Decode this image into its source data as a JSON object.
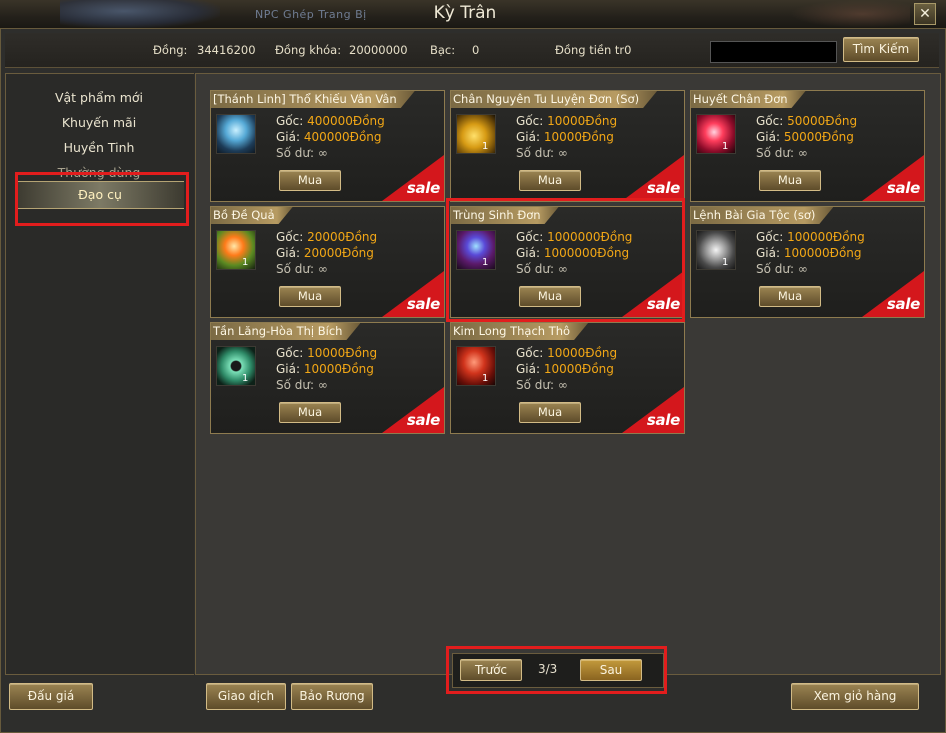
{
  "window": {
    "title": "Kỳ Trân",
    "background_subtitle": "NPC Ghép Trang Bị",
    "close_glyph": "✕"
  },
  "currency": {
    "dong_label": "Đồng:",
    "dong_value": "34416200",
    "dong_khoa_label": "Đồng khóa:",
    "dong_khoa_value": "20000000",
    "bac_label": "Bạc:",
    "bac_value": "0",
    "dong_tien_label": "Đồng tiền tr0",
    "search_button": "Tìm Kiếm"
  },
  "sidebar": {
    "items": [
      {
        "label": "Vật phẩm mới"
      },
      {
        "label": "Khuyến mãi"
      },
      {
        "label": "Huyền Tinh"
      },
      {
        "label": "Thường dùng"
      },
      {
        "label": "Đạo cụ"
      }
    ],
    "active_index": 4
  },
  "items": [
    {
      "name": "[Thánh Linh] Thổ Khiếu Vân Vân",
      "goc_label": "Gốc:",
      "goc": "400000Đồng",
      "gia_label": "Giá:",
      "gia": "400000Đồng",
      "so_du_label": "Số dư:",
      "so_du": "∞",
      "qty": "",
      "buy": "Mua",
      "sale": "sale",
      "icon": "spirit-figure-icon"
    },
    {
      "name": "Chân Nguyên Tu Luyện Đơn (Sơ)",
      "goc_label": "Gốc:",
      "goc": "10000Đồng",
      "gia_label": "Giá:",
      "gia": "10000Đồng",
      "so_du_label": "Số dư:",
      "so_du": "∞",
      "qty": "1",
      "buy": "Mua",
      "sale": "sale",
      "icon": "golden-fruit-icon"
    },
    {
      "name": "Huyết Chân Đơn",
      "goc_label": "Gốc:",
      "goc": "50000Đồng",
      "gia_label": "Giá:",
      "gia": "50000Đồng",
      "so_du_label": "Số dư:",
      "so_du": "∞",
      "qty": "1",
      "buy": "Mua",
      "sale": "sale",
      "icon": "red-orb-icon"
    },
    {
      "name": "Bồ Đề Quả",
      "goc_label": "Gốc:",
      "goc": "20000Đồng",
      "gia_label": "Giá:",
      "gia": "20000Đồng",
      "so_du_label": "Số dư:",
      "so_du": "∞",
      "qty": "1",
      "buy": "Mua",
      "sale": "sale",
      "icon": "orange-flower-icon"
    },
    {
      "name": "Trùng Sinh Đơn",
      "goc_label": "Gốc:",
      "goc": "1000000Đồng",
      "gia_label": "Giá:",
      "gia": "1000000Đồng",
      "so_du_label": "Số dư:",
      "so_du": "∞",
      "qty": "1",
      "buy": "Mua",
      "sale": "sale",
      "icon": "purple-orb-icon"
    },
    {
      "name": "Lệnh Bài Gia Tộc (sơ)",
      "goc_label": "Gốc:",
      "goc": "100000Đồng",
      "gia_label": "Giá:",
      "gia": "100000Đồng",
      "so_du_label": "Số dư:",
      "so_du": "∞",
      "qty": "1",
      "buy": "Mua",
      "sale": "sale",
      "icon": "stone-token-icon"
    },
    {
      "name": "Tần Lăng-Hòa Thị Bích",
      "goc_label": "Gốc:",
      "goc": "10000Đồng",
      "gia_label": "Giá:",
      "gia": "10000Đồng",
      "so_du_label": "Số dư:",
      "so_du": "∞",
      "qty": "1",
      "buy": "Mua",
      "sale": "sale",
      "icon": "jade-disc-icon"
    },
    {
      "name": "Kim Long Thạch Thô",
      "goc_label": "Gốc:",
      "goc": "10000Đồng",
      "gia_label": "Giá:",
      "gia": "10000Đồng",
      "so_du_label": "Số dư:",
      "so_du": "∞",
      "qty": "1",
      "buy": "Mua",
      "sale": "sale",
      "icon": "red-ore-icon"
    }
  ],
  "bottom": {
    "auction": "Đấu giá",
    "trade": "Giao dịch",
    "treasure": "Bảo Rương",
    "prev": "Trước",
    "page": "3/3",
    "next": "Sau",
    "cart": "Xem giỏ hàng"
  }
}
